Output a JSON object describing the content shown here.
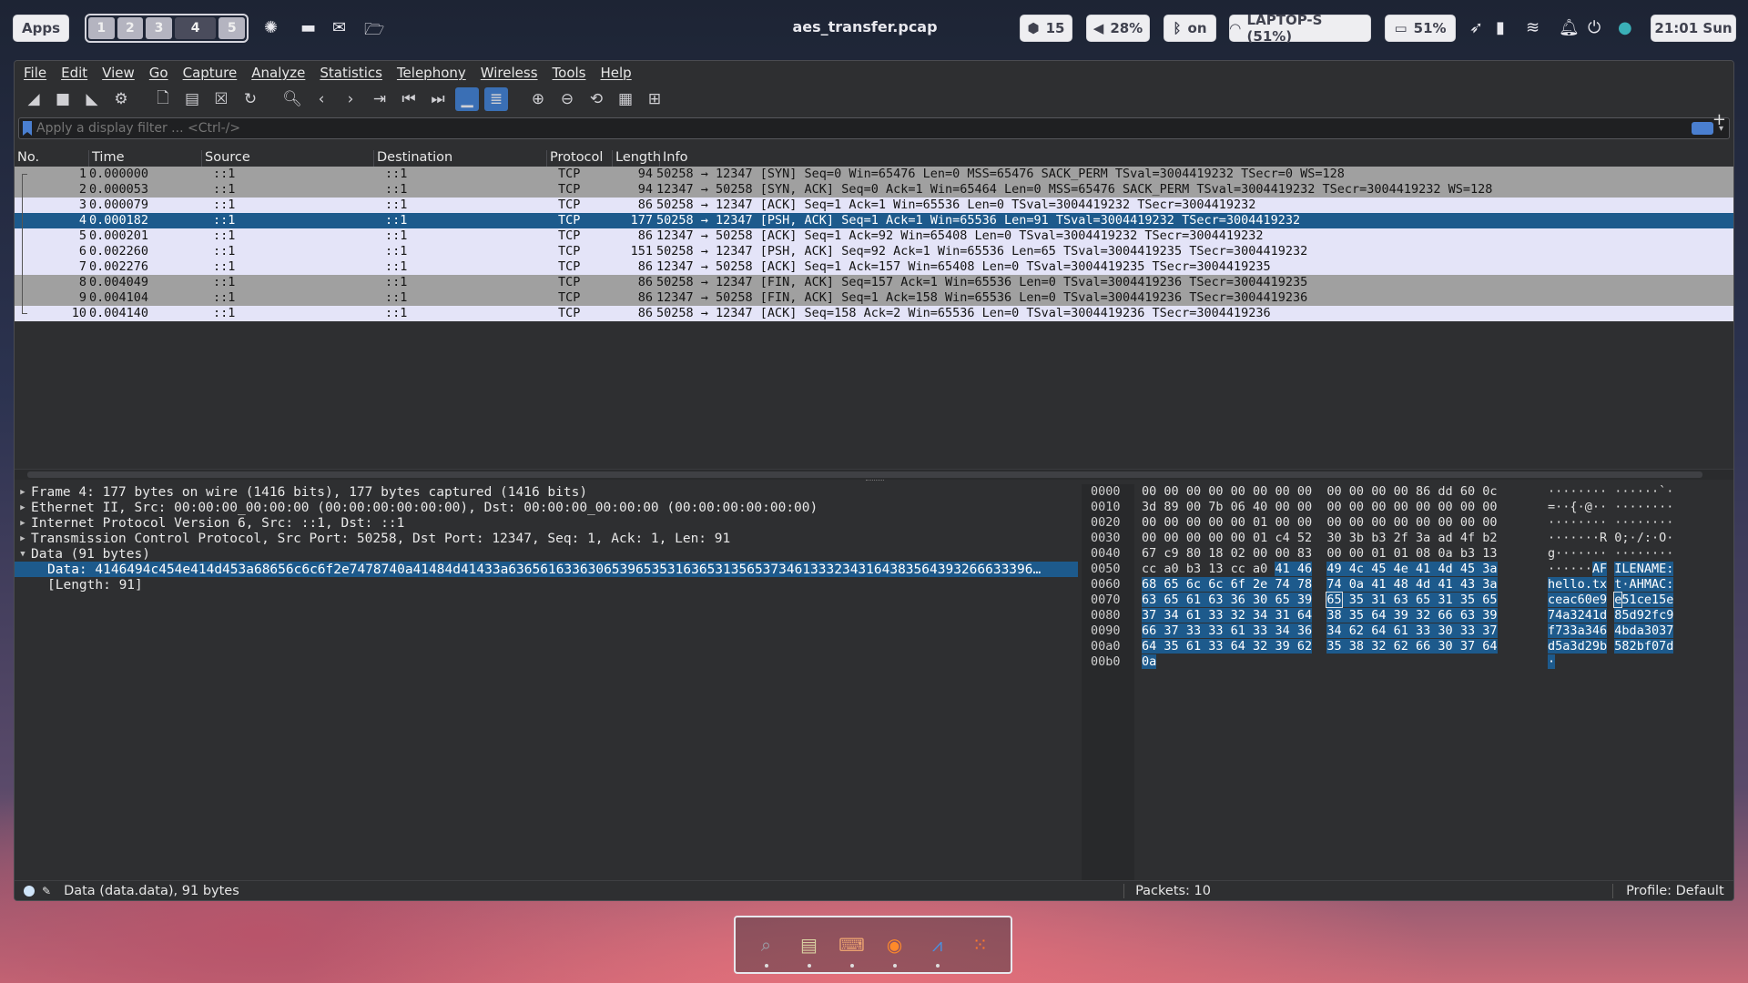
{
  "topbar": {
    "apps_label": "Apps",
    "workspaces": [
      "1",
      "2",
      "3",
      "4",
      "5"
    ],
    "active_workspace": "4",
    "window_title": "aes_transfer.pcap",
    "updates_count": "15",
    "volume": "28%",
    "bluetooth": "on",
    "wifi": "LAPTOP-S (51%)",
    "battery": "51%",
    "clock": "21:01 Sun"
  },
  "menu": [
    "File",
    "Edit",
    "View",
    "Go",
    "Capture",
    "Analyze",
    "Statistics",
    "Telephony",
    "Wireless",
    "Tools",
    "Help"
  ],
  "filter": {
    "placeholder": "Apply a display filter ... <Ctrl-/>"
  },
  "columns": [
    "No.",
    "Time",
    "Source",
    "Destination",
    "Protocol",
    "Length",
    "Info"
  ],
  "packets": [
    {
      "no": "1",
      "time": "0.000000",
      "src": "::1",
      "dst": "::1",
      "proto": "TCP",
      "len": "94",
      "info": "50258 → 12347 [SYN] Seq=0 Win=65476 Len=0 MSS=65476 SACK_PERM TSval=3004419232 TSecr=0 WS=128",
      "style": "syn"
    },
    {
      "no": "2",
      "time": "0.000053",
      "src": "::1",
      "dst": "::1",
      "proto": "TCP",
      "len": "94",
      "info": "12347 → 50258 [SYN, ACK] Seq=0 Ack=1 Win=65464 Len=0 MSS=65476 SACK_PERM TSval=3004419232 TSecr=3004419232 WS=128",
      "style": "syn"
    },
    {
      "no": "3",
      "time": "0.000079",
      "src": "::1",
      "dst": "::1",
      "proto": "TCP",
      "len": "86",
      "info": "50258 → 12347 [ACK] Seq=1 Ack=1 Win=65536 Len=0 TSval=3004419232 TSecr=3004419232",
      "style": "tcp"
    },
    {
      "no": "4",
      "time": "0.000182",
      "src": "::1",
      "dst": "::1",
      "proto": "TCP",
      "len": "177",
      "info": "50258 → 12347 [PSH, ACK] Seq=1 Ack=1 Win=65536 Len=91 TSval=3004419232 TSecr=3004419232",
      "style": "sel"
    },
    {
      "no": "5",
      "time": "0.000201",
      "src": "::1",
      "dst": "::1",
      "proto": "TCP",
      "len": "86",
      "info": "12347 → 50258 [ACK] Seq=1 Ack=92 Win=65408 Len=0 TSval=3004419232 TSecr=3004419232",
      "style": "tcp"
    },
    {
      "no": "6",
      "time": "0.002260",
      "src": "::1",
      "dst": "::1",
      "proto": "TCP",
      "len": "151",
      "info": "50258 → 12347 [PSH, ACK] Seq=92 Ack=1 Win=65536 Len=65 TSval=3004419235 TSecr=3004419232",
      "style": "tcp"
    },
    {
      "no": "7",
      "time": "0.002276",
      "src": "::1",
      "dst": "::1",
      "proto": "TCP",
      "len": "86",
      "info": "12347 → 50258 [ACK] Seq=1 Ack=157 Win=65408 Len=0 TSval=3004419235 TSecr=3004419235",
      "style": "tcp"
    },
    {
      "no": "8",
      "time": "0.004049",
      "src": "::1",
      "dst": "::1",
      "proto": "TCP",
      "len": "86",
      "info": "50258 → 12347 [FIN, ACK] Seq=157 Ack=1 Win=65536 Len=0 TSval=3004419236 TSecr=3004419235",
      "style": "syn"
    },
    {
      "no": "9",
      "time": "0.004104",
      "src": "::1",
      "dst": "::1",
      "proto": "TCP",
      "len": "86",
      "info": "12347 → 50258 [FIN, ACK] Seq=1 Ack=158 Win=65536 Len=0 TSval=3004419236 TSecr=3004419236",
      "style": "syn"
    },
    {
      "no": "10",
      "time": "0.004140",
      "src": "::1",
      "dst": "::1",
      "proto": "TCP",
      "len": "86",
      "info": "50258 → 12347 [ACK] Seq=158 Ack=2 Win=65536 Len=0 TSval=3004419236 TSecr=3004419236",
      "style": "tcp"
    }
  ],
  "details": {
    "frame": "Frame 4: 177 bytes on wire (1416 bits), 177 bytes captured (1416 bits)",
    "ethernet": "Ethernet II, Src: 00:00:00_00:00:00 (00:00:00:00:00:00), Dst: 00:00:00_00:00:00 (00:00:00:00:00:00)",
    "ipv6": "Internet Protocol Version 6, Src: ::1, Dst: ::1",
    "tcp": "Transmission Control Protocol, Src Port: 50258, Dst Port: 12347, Seq: 1, Ack: 1, Len: 91",
    "data": "Data (91 bytes)",
    "data_value": "Data: 4146494c454e414d453a68656c6c6f2e7478740a41484d41433a636561633630653965353163653135653734613332343164383564393266633396…",
    "data_length": "[Length: 91]"
  },
  "bytes": {
    "offsets": [
      "0000",
      "0010",
      "0020",
      "0030",
      "0040",
      "0050",
      "0060",
      "0070",
      "0080",
      "0090",
      "00a0",
      "00b0"
    ],
    "hex": [
      "00 00 00 00 00 00 00 00  00 00 00 00 86 dd 60 0c",
      "3d 89 00 7b 06 40 00 00  00 00 00 00 00 00 00 00",
      "00 00 00 00 00 01 00 00  00 00 00 00 00 00 00 00",
      "00 00 00 00 00 01 c4 52  30 3b b3 2f 3a ad 4f b2",
      "67 c9 80 18 02 00 00 83  00 00 01 01 08 0a b3 13",
      "cc a0 b3 13 cc a0 41 46  49 4c 45 4e 41 4d 45 3a",
      "68 65 6c 6c 6f 2e 74 78  74 0a 41 48 4d 41 43 3a",
      "63 65 61 63 36 30 65 39  65 35 31 63 65 31 35 65",
      "37 34 61 33 32 34 31 64  38 35 64 39 32 66 63 39",
      "66 37 33 33 61 33 34 36  34 62 64 61 33 30 33 37",
      "64 35 61 33 64 32 39 62  35 38 32 62 66 30 37 64",
      "0a"
    ],
    "ascii": [
      "········ ······`·",
      "=··{·@·· ········",
      "········ ········",
      "·······R 0;·/:·O·",
      "g······· ········",
      "······AF ILENAME:",
      "hello.tx t·AHMAC:",
      "ceac60e9 e51ce15e",
      "74a3241d 85d92fc9",
      "f733a346 4bda3037",
      "d5a3d29b 582bf07d",
      "·"
    ]
  },
  "status": {
    "field": "Data (data.data), 91 bytes",
    "packets": "Packets: 10",
    "profile": "Profile: Default"
  },
  "colors": {
    "selected": "#1d5a8c",
    "syn_row": "#a0a0a0",
    "tcp_row": "#e4e4f8"
  }
}
